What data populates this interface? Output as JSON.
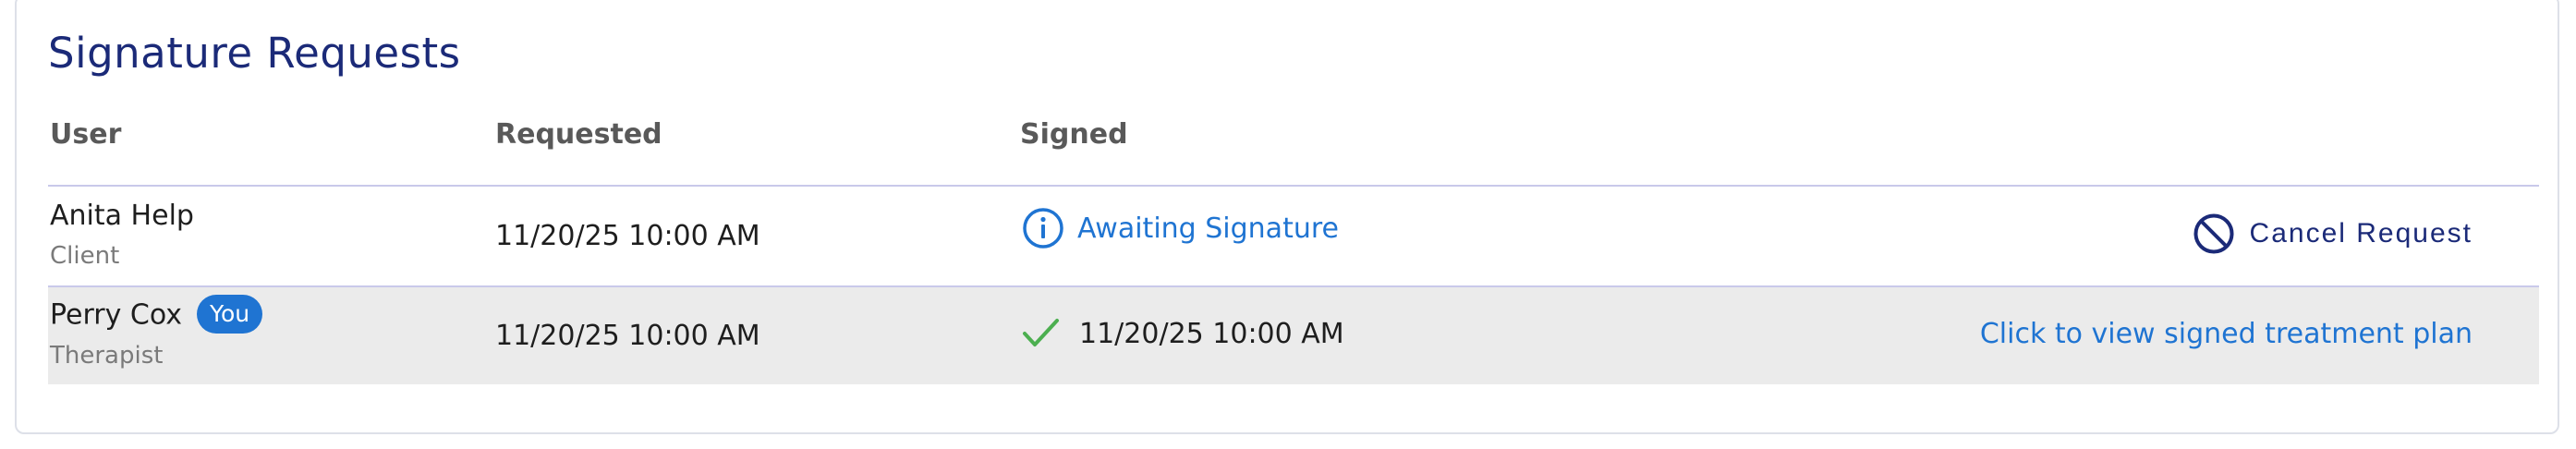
{
  "section": {
    "title": "Signature Requests"
  },
  "table": {
    "columns": {
      "user": "User",
      "requested": "Requested",
      "signed": "Signed"
    },
    "rows": [
      {
        "name": "Anita Help",
        "role": "Client",
        "requested": "11/20/25 10:00 AM",
        "signed_status": "Awaiting Signature",
        "signed_icon": "info-circle-icon",
        "action_label": "Cancel Request",
        "action_icon": "cancel-icon"
      },
      {
        "name": "Perry Cox",
        "badge": "You",
        "role": "Therapist",
        "requested": "11/20/25 10:00 AM",
        "signed_status": "11/20/25 10:00 AM",
        "signed_icon": "checkmark-icon",
        "action_label": "Click to view signed treatment plan"
      }
    ]
  },
  "colors": {
    "title": "#1b2a78",
    "link": "#1f74d2",
    "success": "#4caf50",
    "badge": "#1f74d2",
    "row_alt": "#ebebeb"
  }
}
